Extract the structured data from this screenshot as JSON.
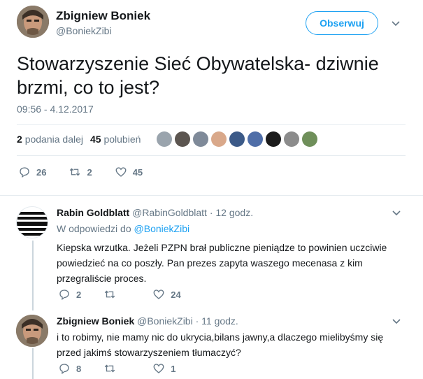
{
  "tweet": {
    "author_name": "Zbigniew Boniek",
    "author_handle": "@BoniekZibi",
    "follow_label": "Obserwuj",
    "text": "Stowarzyszenie Sieć Obywatelska- dziwnie brzmi, co to jest?",
    "timestamp": "09:56 - 4.12.2017",
    "retweets_count": "2",
    "retweets_label": "podania dalej",
    "likes_count": "45",
    "likes_label": "polubień",
    "actions": {
      "replies": "26",
      "retweets": "2",
      "likes": "45"
    }
  },
  "replies": [
    {
      "name": "Rabin Goldblatt",
      "handle": "@RabinGoldblatt",
      "time": "· 12 godz.",
      "avatar_text": "Rabin Goldblatt",
      "reply_to_prefix": "W odpowiedzi do",
      "reply_to_handle": "@BoniekZibi",
      "text": "Kiepska wrzutka. Jeżeli PZPN brał publiczne pieniądze to powinien uczciwie powiedzieć na co poszły. Pan prezes zapyta waszego mecenasa z kim przegraliście proces.",
      "actions": {
        "replies": "2",
        "retweets": "",
        "likes": "24"
      }
    },
    {
      "name": "Zbigniew Boniek",
      "handle": "@BoniekZibi",
      "time": "· 11 godz.",
      "text": "i to robimy, nie mamy nic do ukrycia,bilans jawny,a dlaczego mielibyśmy się przed jakimś stowarzyszeniem tłumaczyć?",
      "actions": {
        "replies": "8",
        "retweets": "",
        "likes": "1"
      }
    }
  ],
  "colors": {
    "accent": "#1da1f2",
    "muted": "#657786",
    "text": "#14171a",
    "border": "#e6ecf0"
  }
}
